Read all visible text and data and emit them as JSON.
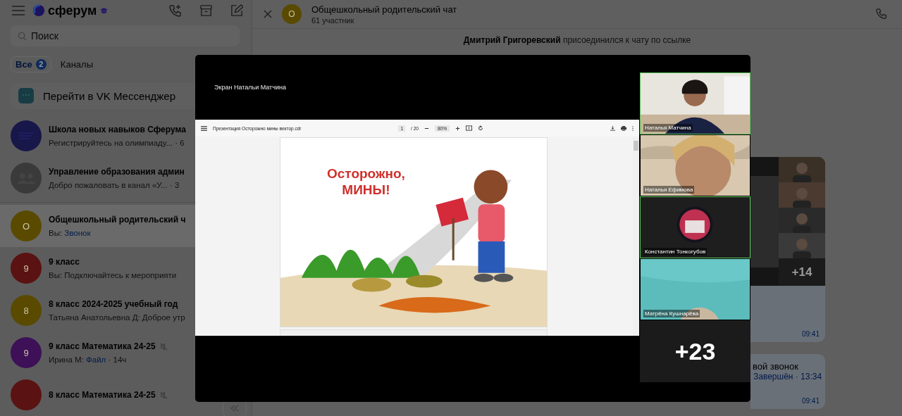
{
  "sidebar": {
    "brand": "сферум",
    "search": {
      "placeholder": "Поиск"
    },
    "filters": [
      {
        "label": "Все",
        "badge": "2",
        "selected": true
      },
      {
        "label": "Каналы",
        "selected": false
      }
    ],
    "promo": "Перейти в VK Мессенджер",
    "chats": [
      {
        "name": "Школа новых навыков Сферума",
        "preview": "Регистрируйтесь на олимпиаду... · 6",
        "kind": "logo",
        "color": "#17174a",
        "muted": false,
        "selected": false
      },
      {
        "name": "Управление образования админ",
        "preview": "Добро пожаловать в канал «У... · 3",
        "kind": "group",
        "color": "#3a3a3a",
        "muted": false,
        "selected": false
      },
      {
        "name": "Общешкольный родительский ч",
        "preview": "Вы:",
        "attachment": "Звонок",
        "kind": "letter",
        "avatar": "О",
        "color": "#5a4a00",
        "muted": false,
        "selected": true
      },
      {
        "name": "9 класс",
        "preview": "Вы: Подключайтесь к мероприяти",
        "kind": "letter",
        "avatar": "9",
        "color": "#5a1212",
        "muted": false,
        "selected": false
      },
      {
        "name": "8 класс 2024-2025 учебный год",
        "preview": "Татьяна Анатольевна Д: Доброе утр",
        "kind": "letter",
        "avatar": "8",
        "color": "#5a4a00",
        "muted": false,
        "selected": false
      },
      {
        "name": "9 класс Математика 24-25",
        "preview": "Ирина М:",
        "attachment": "Файл",
        "time": "· 14ч",
        "kind": "letter",
        "avatar": "9",
        "color": "#3d1058",
        "muted": true,
        "selected": false
      },
      {
        "name": "8 класс Математика 24-25",
        "kind": "letter",
        "color": "#5a1212",
        "muted": true,
        "selected": false
      }
    ]
  },
  "chat": {
    "title": "Общешкольный родительский чат",
    "subtitle": "61 участник",
    "avatar": "О",
    "system_message": "**Дмитрий Григоревский** присоединился к чату по ссылке",
    "messages": [
      {
        "kind": "call_preview",
        "count": "+14",
        "time": "09:41"
      },
      {
        "kind": "call_ended",
        "title": "вой звонок",
        "status": "Завершён · 13:34",
        "time": "09:41"
      }
    ]
  },
  "call": {
    "screen_label": "Экран Натальи Матчина",
    "viewer": {
      "file_name": "Презентация Осторожно мины вектор.cdr",
      "page": "1",
      "page_total": "/ 20",
      "zoom": "80%"
    },
    "slide": {
      "title": "Осторожно,",
      "subtitle": "МИНЫ!"
    },
    "participants": [
      {
        "name": "Наталья Матчина",
        "speaking": true,
        "kind": "video"
      },
      {
        "name": "Наталья Ефимова",
        "speaking": false,
        "kind": "video"
      },
      {
        "name": "Константин Тонкогубов",
        "speaking": true,
        "kind": "avatar"
      },
      {
        "name": "Матрёна Кушнарёва",
        "speaking": false,
        "kind": "video"
      }
    ],
    "more_count": "+23"
  }
}
